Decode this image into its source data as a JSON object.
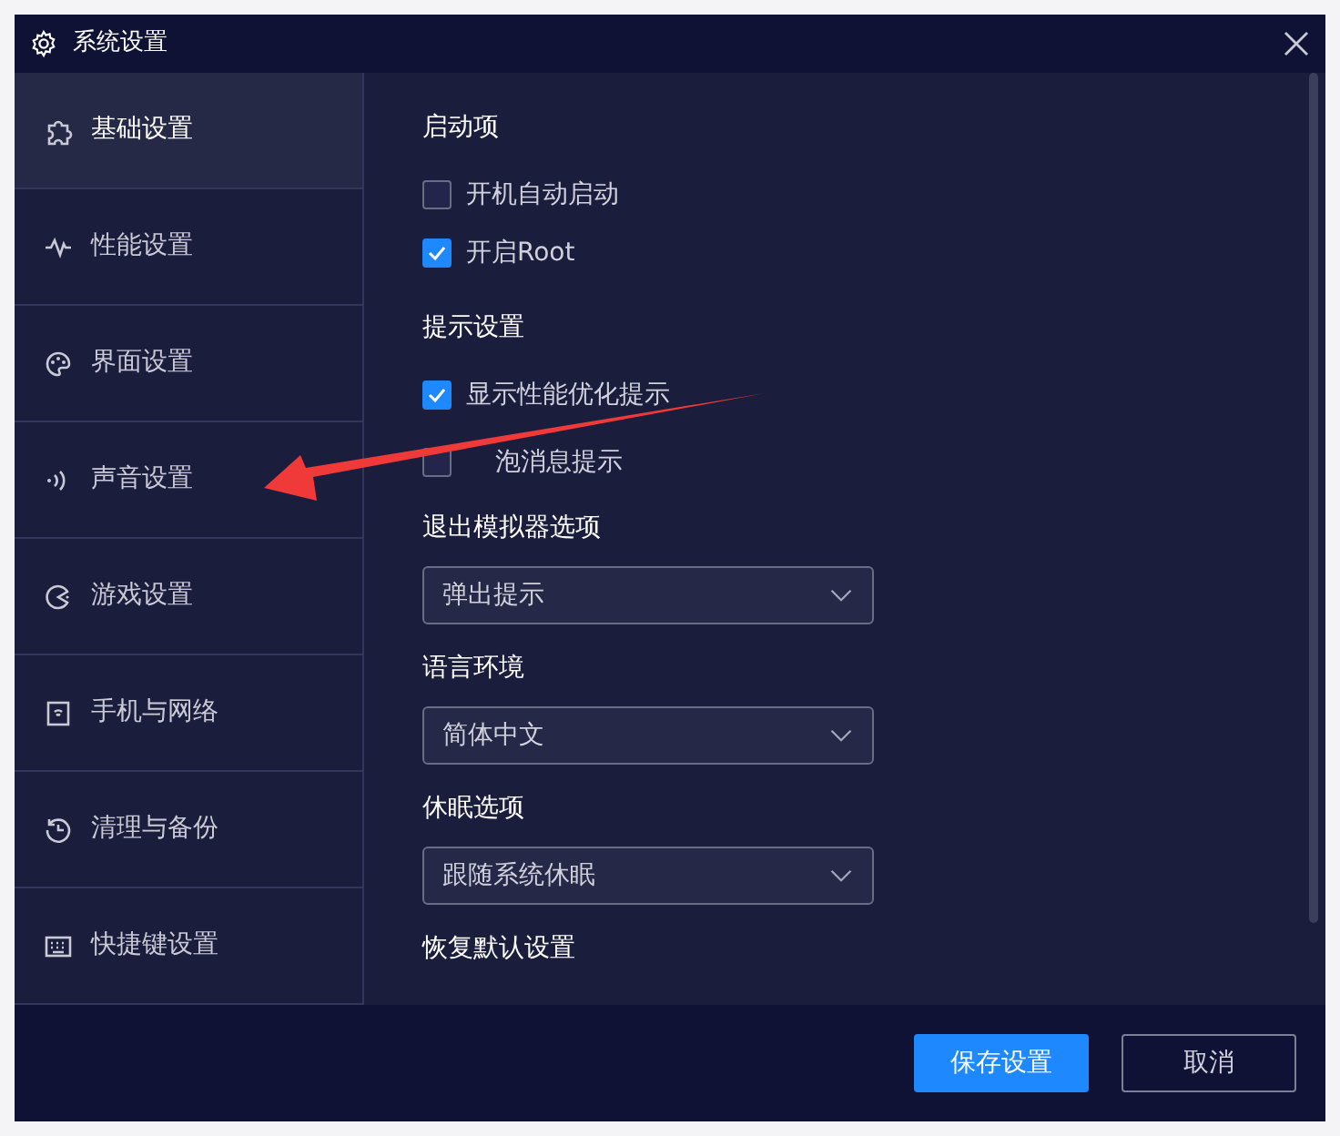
{
  "window": {
    "title": "系统设置"
  },
  "sidebar": {
    "items": [
      {
        "label": "基础设置",
        "selected": true
      },
      {
        "label": "性能设置",
        "selected": false
      },
      {
        "label": "界面设置",
        "selected": false
      },
      {
        "label": "声音设置",
        "selected": false
      },
      {
        "label": "游戏设置",
        "selected": false
      },
      {
        "label": "手机与网络",
        "selected": false
      },
      {
        "label": "清理与备份",
        "selected": false
      },
      {
        "label": "快捷键设置",
        "selected": false
      }
    ]
  },
  "sections": [
    {
      "title": "启动项",
      "kind": "checks",
      "options": [
        {
          "label": "开机自动启动",
          "checked": false
        },
        {
          "label": "开启Root",
          "checked": true
        }
      ]
    },
    {
      "title": "提示设置",
      "kind": "checks",
      "options": [
        {
          "label": "显示性能优化提示",
          "checked": true
        },
        {
          "label": "泡消息提示",
          "checked": false
        }
      ]
    },
    {
      "title": "退出模拟器选项",
      "kind": "select",
      "value": "弹出提示"
    },
    {
      "title": "语言环境",
      "kind": "select",
      "value": "简体中文"
    },
    {
      "title": "休眠选项",
      "kind": "select",
      "value": "跟随系统休眠"
    },
    {
      "title": "恢复默认设置",
      "kind": "heading"
    }
  ],
  "buttons": [
    {
      "label": "保存设置",
      "kind": "primary"
    },
    {
      "label": "取消",
      "kind": "outline"
    }
  ]
}
